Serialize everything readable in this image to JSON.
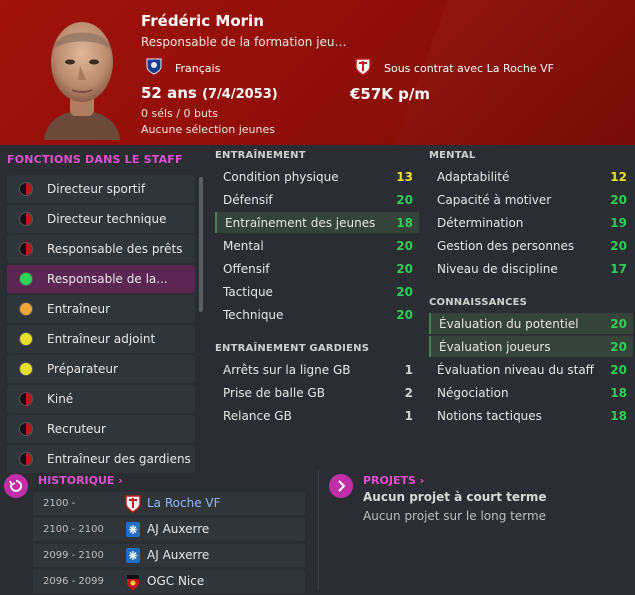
{
  "profile": {
    "name": "Frédéric Morin",
    "role": "Responsable de la formation jeu…",
    "nationality": "Français",
    "contract": "Sous contrat avec La Roche VF",
    "age": "52 ans",
    "dob": "(7/4/2053)",
    "wage": "€57K p/m",
    "caps": "0 séls / 0 buts",
    "youth_caps": "Aucune sélection jeunes"
  },
  "staff_functions": {
    "title": "FONCTIONS DANS LE STAFF",
    "items": [
      {
        "label": "Directeur sportif",
        "color": "#111111"
      },
      {
        "label": "Directeur technique",
        "color": "#111111"
      },
      {
        "label": "Responsable des prêts",
        "color": "#111111"
      },
      {
        "label": "Responsable de la...",
        "color": "#2ed15a"
      },
      {
        "label": "Entraîneur",
        "color": "#f0a63a"
      },
      {
        "label": "Entraîneur adjoint",
        "color": "#e8df2a"
      },
      {
        "label": "Préparateur",
        "color": "#e8df2a"
      },
      {
        "label": "Kiné",
        "color": "#111111"
      },
      {
        "label": "Recruteur",
        "color": "#111111"
      },
      {
        "label": "Entraîneur des gardiens",
        "color": "#111111"
      }
    ]
  },
  "training": {
    "title": "ENTRAÎNEMENT",
    "rows": [
      {
        "name": "Condition physique",
        "value": "13",
        "tone": "y"
      },
      {
        "name": "Défensif",
        "value": "20",
        "tone": "g"
      },
      {
        "name": "Entraînement des jeunes",
        "value": "18",
        "tone": "g"
      },
      {
        "name": "Mental",
        "value": "20",
        "tone": "g"
      },
      {
        "name": "Offensif",
        "value": "20",
        "tone": "g"
      },
      {
        "name": "Tactique",
        "value": "20",
        "tone": "g"
      },
      {
        "name": "Technique",
        "value": "20",
        "tone": "g"
      }
    ]
  },
  "gk_training": {
    "title": "ENTRAÎNEMENT GARDIENS",
    "rows": [
      {
        "name": "Arrêts sur la ligne GB",
        "value": "1",
        "tone": "w"
      },
      {
        "name": "Prise de balle GB",
        "value": "2",
        "tone": "w"
      },
      {
        "name": "Relance GB",
        "value": "1",
        "tone": "w"
      }
    ]
  },
  "mental": {
    "title": "MENTAL",
    "rows": [
      {
        "name": "Adaptabilité",
        "value": "12",
        "tone": "y"
      },
      {
        "name": "Capacité à motiver",
        "value": "20",
        "tone": "g"
      },
      {
        "name": "Détermination",
        "value": "19",
        "tone": "g"
      },
      {
        "name": "Gestion des personnes",
        "value": "20",
        "tone": "g"
      },
      {
        "name": "Niveau de discipline",
        "value": "17",
        "tone": "g"
      }
    ]
  },
  "knowledge": {
    "title": "CONNAISSANCES",
    "rows": [
      {
        "name": "Évaluation du potentiel",
        "value": "20",
        "tone": "g"
      },
      {
        "name": "Évaluation joueurs",
        "value": "20",
        "tone": "g"
      },
      {
        "name": "Évaluation niveau du staff",
        "value": "20",
        "tone": "g"
      },
      {
        "name": "Négociation",
        "value": "18",
        "tone": "g"
      },
      {
        "name": "Notions tactiques",
        "value": "18",
        "tone": "g"
      }
    ]
  },
  "history": {
    "title": "HISTORIQUE",
    "rows": [
      {
        "years": "2100 -",
        "club": "La Roche VF"
      },
      {
        "years": "2100 - 2100",
        "club": "AJ Auxerre"
      },
      {
        "years": "2099 - 2100",
        "club": "AJ Auxerre"
      },
      {
        "years": "2096 - 2099",
        "club": "OGC Nice"
      }
    ]
  },
  "projects": {
    "title": "PROJETS",
    "short_term": "Aucun projet à court terme",
    "long_term": "Aucun projet sur le long terme"
  }
}
